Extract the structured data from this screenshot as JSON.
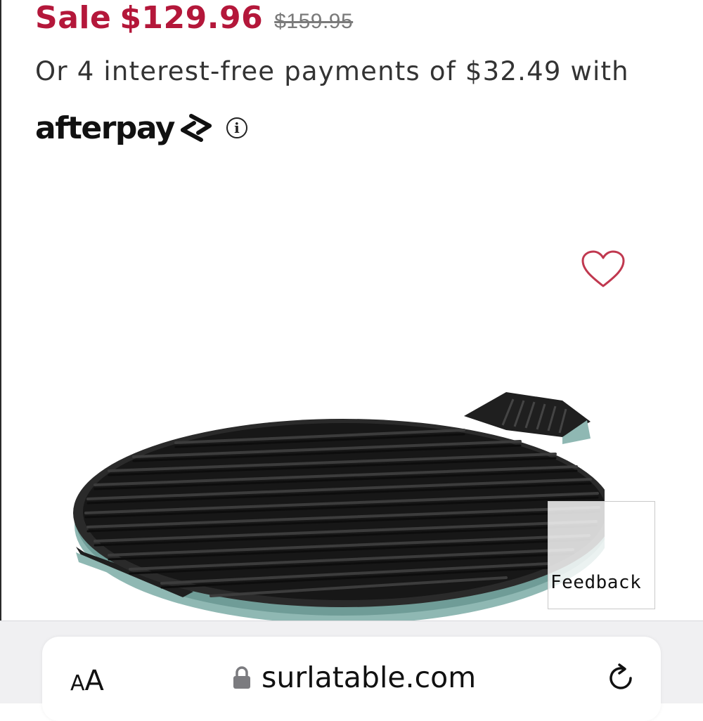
{
  "pricing": {
    "sale_label": "Sale",
    "sale_price": "$129.96",
    "original_price": "$159.95"
  },
  "installments_text": "Or 4 interest-free payments of $32.49 with",
  "afterpay": {
    "brand": "afterpay",
    "info_glyph": "i"
  },
  "icons": {
    "wishlist": "heart-outline-icon",
    "info": "info-circle-icon",
    "lock": "lock-icon",
    "reload": "reload-icon"
  },
  "product_image": {
    "subject": "grill-pan-image"
  },
  "feedback": {
    "label": "Feedback"
  },
  "browser": {
    "text_size_small": "A",
    "text_size_large": "A",
    "url": "surlatable.com"
  },
  "colors": {
    "sale_red": "#b4173a",
    "wishlist_red": "#c0384f",
    "pan_teal": "#8fb8b3",
    "pan_black": "#1a1a1a"
  }
}
